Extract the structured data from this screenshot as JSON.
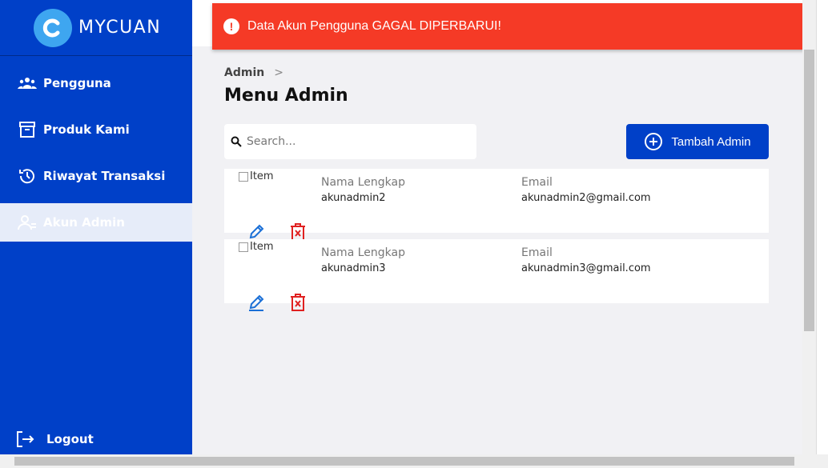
{
  "brand": {
    "name": "MYCUAN",
    "color": "#0040c8",
    "accent": "#3ea6f0"
  },
  "sidebar": {
    "items": [
      {
        "label": "Pengguna",
        "icon": "users-icon"
      },
      {
        "label": "Produk Kami",
        "icon": "archive-icon"
      },
      {
        "label": "Riwayat Transaksi",
        "icon": "history-icon"
      },
      {
        "label": "Akun Admin",
        "icon": "user-admin-icon",
        "active": true
      }
    ],
    "logout": "Logout"
  },
  "toast": {
    "message": "Data Akun Pengguna GAGAL DIPERBARUI!",
    "color": "#f53a26"
  },
  "breadcrumb": {
    "root": "Admin",
    "sep": ">"
  },
  "page_title": "Menu Admin",
  "search": {
    "placeholder": "Search...",
    "value": ""
  },
  "add_button": "Tambah Admin",
  "labels": {
    "name": "Nama Lengkap",
    "email": "Email",
    "image_alt": "Item"
  },
  "admins": [
    {
      "name": "akunadmin2",
      "email": "akunadmin2@gmail.com"
    },
    {
      "name": "akunadmin3",
      "email": "akunadmin3@gmail.com"
    }
  ]
}
